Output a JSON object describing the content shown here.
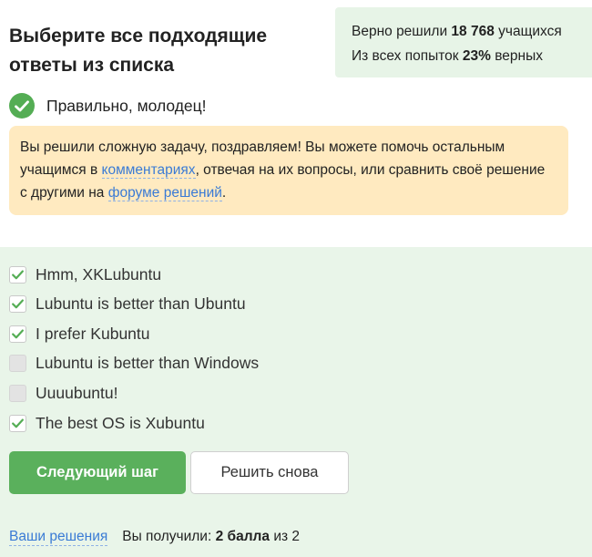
{
  "question": {
    "title": "Выберите все подходящие ответы из списка"
  },
  "stats": {
    "solved_prefix": "Верно решили",
    "solved_count": "18 768",
    "solved_suffix": "учащихся",
    "attempts_prefix": "Из всех попыток",
    "attempts_percent": "23%",
    "attempts_suffix": "верных"
  },
  "verdict": {
    "icon": "check-circle-icon",
    "text": "Правильно, молодец!"
  },
  "notice": {
    "text_1": "Вы решили сложную задачу, поздравляем! Вы можете помочь остальным учащимся в",
    "link_comments": "комментариях",
    "text_2": ", отвечая на их вопросы, или сравнить своё решение с другими на",
    "link_forum": "форуме решений",
    "text_3": "."
  },
  "options": [
    {
      "label": "Hmm, XKLubuntu",
      "checked": true
    },
    {
      "label": "Lubuntu is better than Ubuntu",
      "checked": true
    },
    {
      "label": "I prefer Kubuntu",
      "checked": true
    },
    {
      "label": "Lubuntu is better than Windows",
      "checked": false
    },
    {
      "label": "Uuuubuntu!",
      "checked": false
    },
    {
      "label": "The best OS is Xubuntu",
      "checked": true
    }
  ],
  "buttons": {
    "next_step": "Следующий шаг",
    "retry": "Решить снова"
  },
  "footer": {
    "your_solutions": "Ваши решения",
    "score_prefix": "Вы получили:",
    "score_value": "2 балла",
    "score_suffix": "из 2"
  },
  "colors": {
    "accent_green": "#5ab05c",
    "answers_bg": "#e9f5e9",
    "notice_bg": "#ffeac0",
    "link": "#3a7bd5"
  }
}
